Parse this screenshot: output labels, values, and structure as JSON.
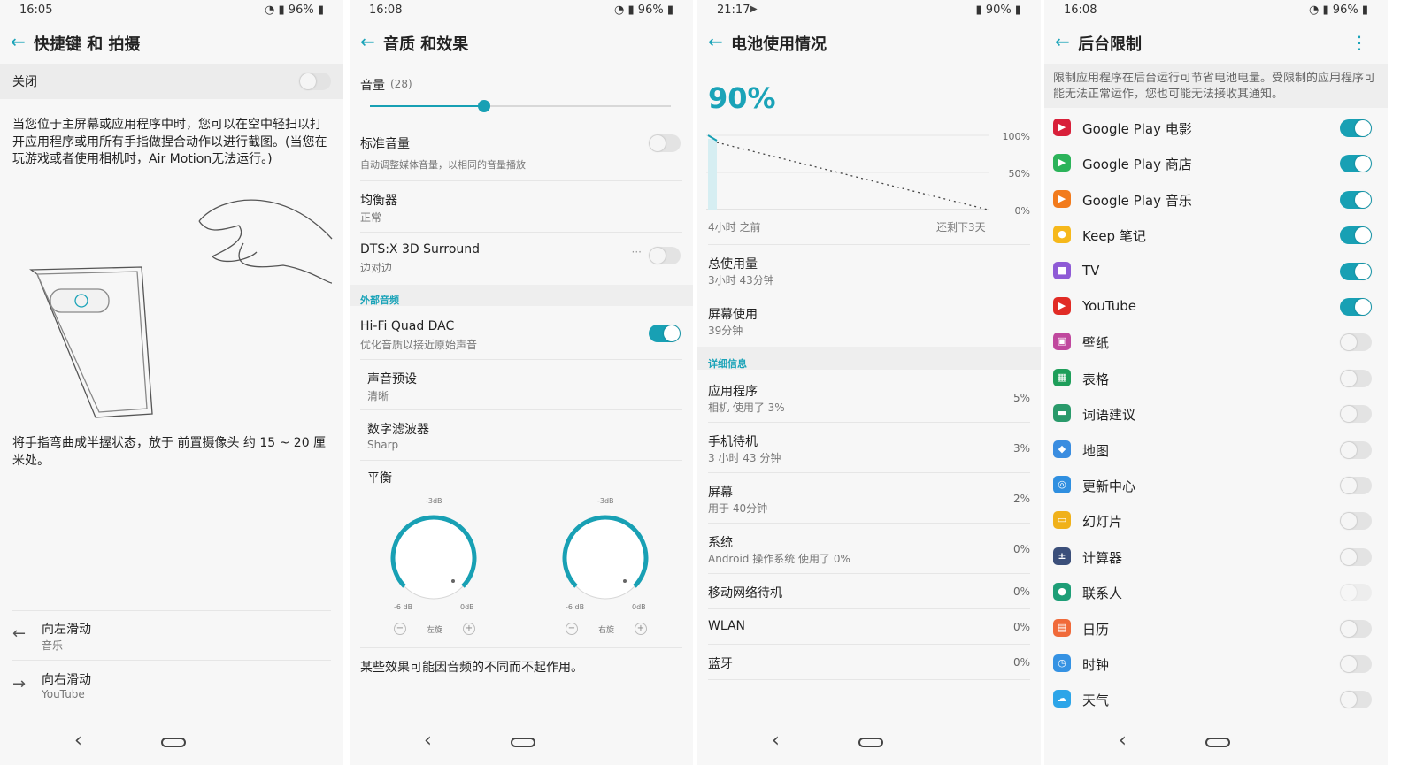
{
  "screen1": {
    "status": {
      "time": "16:05",
      "battery": "96%"
    },
    "title": "快捷键 和 拍摄",
    "off_label": "关闭",
    "toggle_on": false,
    "description": "当您位于主屏幕或应用程序中时，您可以在空中轻扫以打开应用程序或用所有手指做捏合动作以进行截图。(当您在玩游戏或者使用相机时，Air Motion无法运行。)",
    "hint": "将手指弯曲成半握状态，放于 前置摄像头 约 15 ~ 20 厘米处。",
    "gestures": [
      {
        "icon": "arrow-left-icon",
        "title": "向左滑动",
        "subtitle": "音乐"
      },
      {
        "icon": "arrow-right-icon",
        "title": "向右滑动",
        "subtitle": "YouTube"
      }
    ]
  },
  "screen2": {
    "status": {
      "time": "16:08",
      "battery": "96%"
    },
    "title": "音质 和效果",
    "volume_label": "音量",
    "volume_value": "(28)",
    "volume_fraction": 0.38,
    "standard_volume": {
      "title": "标准音量",
      "subtitle": "自动调整媒体音量，以相同的音量播放",
      "on": false
    },
    "equalizer": {
      "title": "均衡器",
      "subtitle": "正常"
    },
    "dts": {
      "title": "DTS:X 3D Surround",
      "subtitle": "边对边",
      "on": false
    },
    "external_header": "外部音频",
    "hifi": {
      "title": "Hi-Fi Quad DAC",
      "subtitle": "优化音质以接近原始声音",
      "on": true
    },
    "sound_preset": {
      "title": "声音预设",
      "subtitle": "清晰"
    },
    "digital_filter": {
      "title": "数字滤波器",
      "subtitle": "Sharp"
    },
    "balance_label": "平衡",
    "knobs": [
      {
        "top": "-3dB",
        "left": "-6 dB",
        "right": "0dB",
        "label": "左旋"
      },
      {
        "top": "-3dB",
        "left": "-6 dB",
        "right": "0dB",
        "label": "右旋"
      }
    ],
    "footer": "某些效果可能因音频的不同而不起作用。"
  },
  "screen3": {
    "status": {
      "time": "21:17",
      "battery": "90%"
    },
    "title": "电池使用情况",
    "battery_percent": "90%",
    "chart_labels": {
      "y100": "100%",
      "y50": "50%",
      "y0": "0%",
      "x_left": "4小时 之前",
      "x_right": "还剩下3天"
    },
    "total_usage": {
      "title": "总使用量",
      "subtitle": "3小时 43分钟"
    },
    "screen_usage": {
      "title": "屏幕使用",
      "subtitle": "39分钟"
    },
    "detail_header": "详细信息",
    "details": [
      {
        "title": "应用程序",
        "subtitle": "相机 使用了 3%",
        "value": "5%"
      },
      {
        "title": "手机待机",
        "subtitle": "3 小时 43 分钟",
        "value": "3%"
      },
      {
        "title": "屏幕",
        "subtitle": "用于 40分钟",
        "value": "2%"
      },
      {
        "title": "系统",
        "subtitle": "Android 操作系统 使用了 0%",
        "value": "0%"
      }
    ],
    "simple_details": [
      {
        "title": "移动网络待机",
        "value": "0%"
      },
      {
        "title": "WLAN",
        "value": "0%"
      },
      {
        "title": "蓝牙",
        "value": "0%"
      }
    ]
  },
  "screen4": {
    "status": {
      "time": "16:08",
      "battery": "96%"
    },
    "title": "后台限制",
    "info": "限制应用程序在后台运行可节省电池电量。受限制的应用程序可能无法正常运作，您也可能无法接收其通知。",
    "apps": [
      {
        "name": "Google Play 电影",
        "icon": "google-play-movies-icon",
        "color": "#d8203a",
        "on": true
      },
      {
        "name": "Google Play 商店",
        "icon": "google-play-store-icon",
        "color": "#2cb35a",
        "on": true
      },
      {
        "name": "Google Play 音乐",
        "icon": "google-play-music-icon",
        "color": "#f27b1c",
        "on": true
      },
      {
        "name": "Keep 笔记",
        "icon": "keep-notes-icon",
        "color": "#f6b81b",
        "on": true
      },
      {
        "name": "TV",
        "icon": "tv-icon",
        "color": "#8f5bd6",
        "on": true
      },
      {
        "name": "YouTube",
        "icon": "youtube-icon",
        "color": "#e12b25",
        "on": true
      },
      {
        "name": "壁纸",
        "icon": "wallpaper-icon",
        "color": "#c0489e",
        "on": false
      },
      {
        "name": "表格",
        "icon": "sheets-icon",
        "color": "#1e9e5a",
        "on": false
      },
      {
        "name": "词语建议",
        "icon": "word-suggest-icon",
        "color": "#2a9a6b",
        "on": false
      },
      {
        "name": "地图",
        "icon": "maps-icon",
        "color": "#3a8de0",
        "on": false
      },
      {
        "name": "更新中心",
        "icon": "update-center-icon",
        "color": "#2f8fe0",
        "on": false
      },
      {
        "name": "幻灯片",
        "icon": "slides-icon",
        "color": "#f0b11a",
        "on": false
      },
      {
        "name": "计算器",
        "icon": "calculator-icon",
        "color": "#3b4f7a",
        "on": false
      },
      {
        "name": "联系人",
        "icon": "contacts-icon",
        "color": "#1e9e77",
        "on": false,
        "dim": true
      },
      {
        "name": "日历",
        "icon": "calendar-icon",
        "color": "#f06a3a",
        "on": false
      },
      {
        "name": "时钟",
        "icon": "clock-icon",
        "color": "#3592e3",
        "on": false
      },
      {
        "name": "天气",
        "icon": "weather-icon",
        "color": "#2da5e8",
        "on": false
      }
    ]
  }
}
